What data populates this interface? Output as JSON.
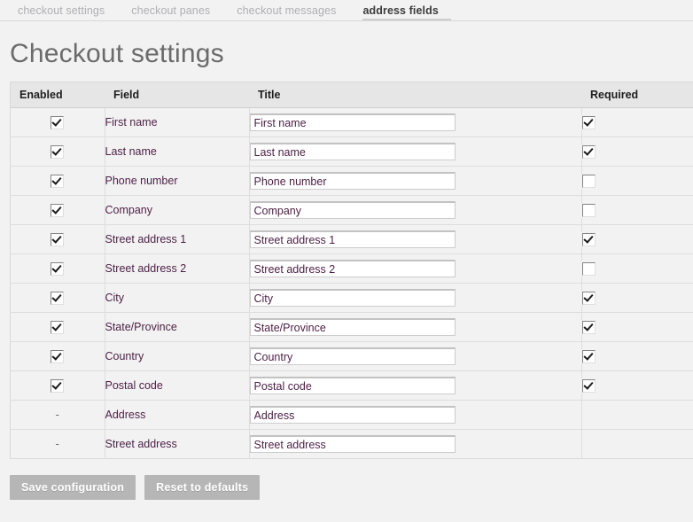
{
  "tabs": [
    {
      "label": "checkout settings",
      "active": false
    },
    {
      "label": "checkout panes",
      "active": false
    },
    {
      "label": "checkout messages",
      "active": false
    },
    {
      "label": "address fields",
      "active": true
    }
  ],
  "page_title": "Checkout settings",
  "table": {
    "headers": {
      "enabled": "Enabled",
      "field": "Field",
      "title": "Title",
      "required": "Required"
    },
    "rows": [
      {
        "enabled": "checked",
        "field": "First name",
        "title": "First name",
        "required": "checked"
      },
      {
        "enabled": "checked",
        "field": "Last name",
        "title": "Last name",
        "required": "checked"
      },
      {
        "enabled": "checked",
        "field": "Phone number",
        "title": "Phone number",
        "required": "unchecked"
      },
      {
        "enabled": "checked",
        "field": "Company",
        "title": "Company",
        "required": "unchecked"
      },
      {
        "enabled": "checked",
        "field": "Street address 1",
        "title": "Street address 1",
        "required": "checked"
      },
      {
        "enabled": "checked",
        "field": "Street address 2",
        "title": "Street address 2",
        "required": "unchecked"
      },
      {
        "enabled": "checked",
        "field": "City",
        "title": "City",
        "required": "checked"
      },
      {
        "enabled": "checked",
        "field": "State/Province",
        "title": "State/Province",
        "required": "checked"
      },
      {
        "enabled": "checked",
        "field": "Country",
        "title": "Country",
        "required": "checked"
      },
      {
        "enabled": "checked",
        "field": "Postal code",
        "title": "Postal code",
        "required": "checked"
      },
      {
        "enabled": "dash",
        "field": "Address",
        "title": "Address",
        "required": "none"
      },
      {
        "enabled": "dash",
        "field": "Street address",
        "title": "Street address",
        "required": "none"
      }
    ],
    "dash_glyph": "-"
  },
  "buttons": {
    "save": "Save configuration",
    "reset": "Reset to defaults"
  },
  "colors": {
    "page_bg": "#f2f2f2",
    "header_bg": "#e6e6e6",
    "link_text": "#4c1f45",
    "title_text": "#6b6b6b",
    "button_bg": "#b6b6b6",
    "tab_inactive": "#b0aeb2",
    "tab_active": "#3b3b3b"
  }
}
